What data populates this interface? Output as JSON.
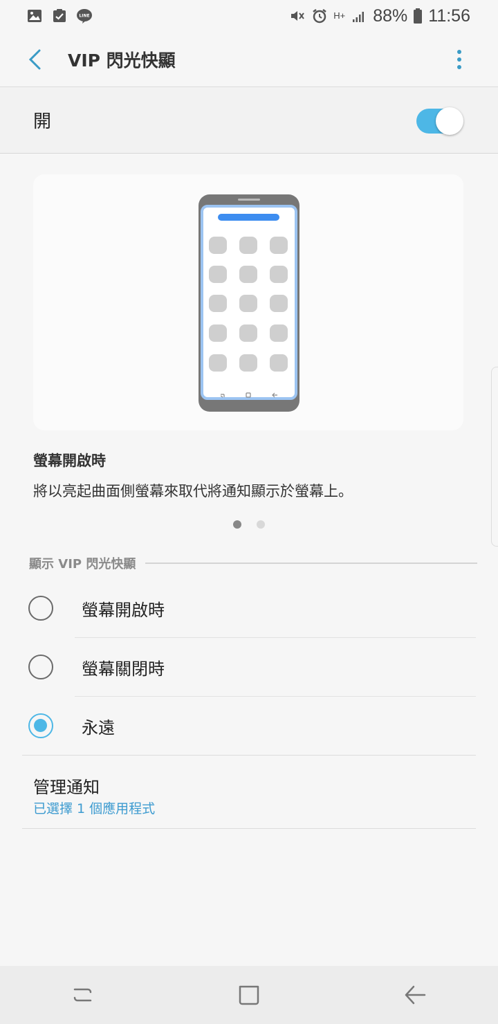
{
  "status_bar": {
    "battery": "88%",
    "time": "11:56",
    "network": "H+",
    "icons": [
      "gallery-icon",
      "clipboard-check-icon",
      "line-app-icon",
      "mute-icon",
      "alarm-icon",
      "network-icon",
      "signal-icon",
      "battery-icon"
    ]
  },
  "app_bar": {
    "title": "VIP 閃光快顯"
  },
  "master_switch": {
    "label": "開",
    "state": "on",
    "accent": "#4db7e6"
  },
  "illustration": {
    "title": "螢幕開啟時",
    "description": "將以亮起曲面側螢幕來取代將通知顯示於螢幕上。",
    "pages": 2,
    "current_page": 1
  },
  "display_section": {
    "header": "顯示 VIP 閃光快顯",
    "options": [
      {
        "label": "螢幕開啟時",
        "checked": false
      },
      {
        "label": "螢幕關閉時",
        "checked": false
      },
      {
        "label": "永遠",
        "checked": true
      }
    ]
  },
  "manage": {
    "title": "管理通知",
    "subtitle": "已選擇 1 個應用程式",
    "subtitle_color": "#3d9bd0"
  },
  "nav_bar": {
    "buttons": [
      "recents-icon",
      "home-icon",
      "back-icon"
    ]
  }
}
